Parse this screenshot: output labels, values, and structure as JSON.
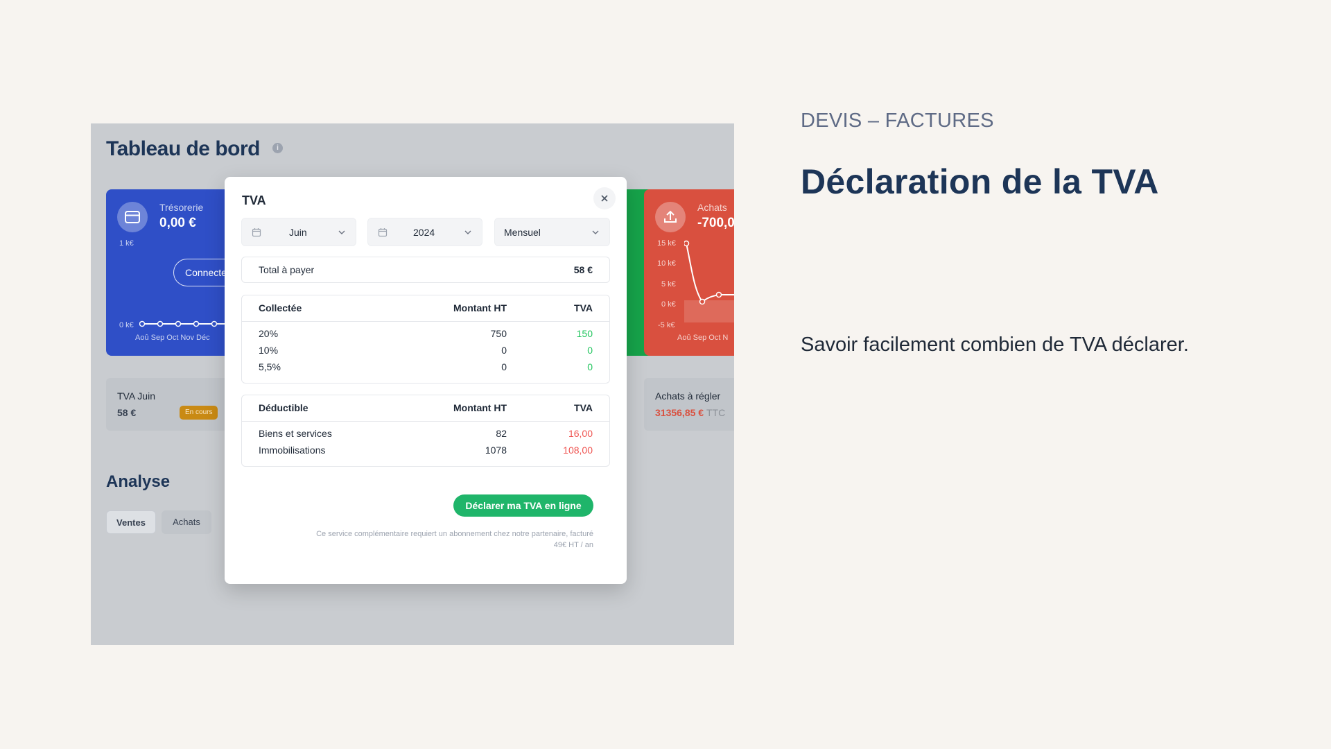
{
  "eyebrow": "DEVIS – FACTURES",
  "headline": "Déclaration de la TVA",
  "subtitle": "Savoir facilement combien de TVA déclarer.",
  "dashboard": {
    "title": "Tableau de bord",
    "info_glyph": "i",
    "tresorerie": {
      "label": "Trésorerie",
      "value": "0,00 €",
      "y_top": "1 k€",
      "y_bottom": "0 k€",
      "months": "Aoû Sep Oct Nov Déc",
      "connect_label": "Connecter",
      "color": "#2f4fc7"
    },
    "achats": {
      "label": "Achats",
      "value": "-700,0",
      "y_ticks": [
        "15 k€",
        "10 k€",
        "5 k€",
        "0 k€",
        "-5 k€"
      ],
      "months": "Aoû Sep Oct N",
      "color": "#d9503f"
    },
    "tva_card": {
      "label": "TVA Juin",
      "value": "58 €",
      "badge": "En cours"
    },
    "achats_card": {
      "label": "Achats à régler",
      "value": "31356,85 €",
      "suffix": "TTC"
    },
    "analyse_title": "Analyse",
    "tabs": [
      "Ventes",
      "Achats"
    ]
  },
  "modal": {
    "title": "TVA",
    "close_glyph": "×",
    "month": "Juin",
    "year": "2024",
    "period": "Mensuel",
    "total_label": "Total à payer",
    "total_value": "58 €",
    "collectee": {
      "headers": [
        "Collectée",
        "Montant HT",
        "TVA"
      ],
      "rows": [
        [
          "20%",
          "750",
          "150"
        ],
        [
          "10%",
          "0",
          "0"
        ],
        [
          "5,5%",
          "0",
          "0"
        ]
      ]
    },
    "deductible": {
      "headers": [
        "Déductible",
        "Montant HT",
        "TVA"
      ],
      "rows": [
        [
          "Biens et services",
          "82",
          "16,00"
        ],
        [
          "Immobilisations",
          "1078",
          "108,00"
        ]
      ]
    },
    "declare_label": "Déclarer ma TVA en ligne",
    "footnote_line1": "Ce service complémentaire requiert un abonnement chez notre partenaire, facturé",
    "footnote_line2": "49€ HT / an"
  },
  "colors": {
    "accent_green": "#1fb56a",
    "tva_positive": "#22c55e",
    "tva_negative": "#ef5350",
    "title_navy": "#1d3557"
  }
}
